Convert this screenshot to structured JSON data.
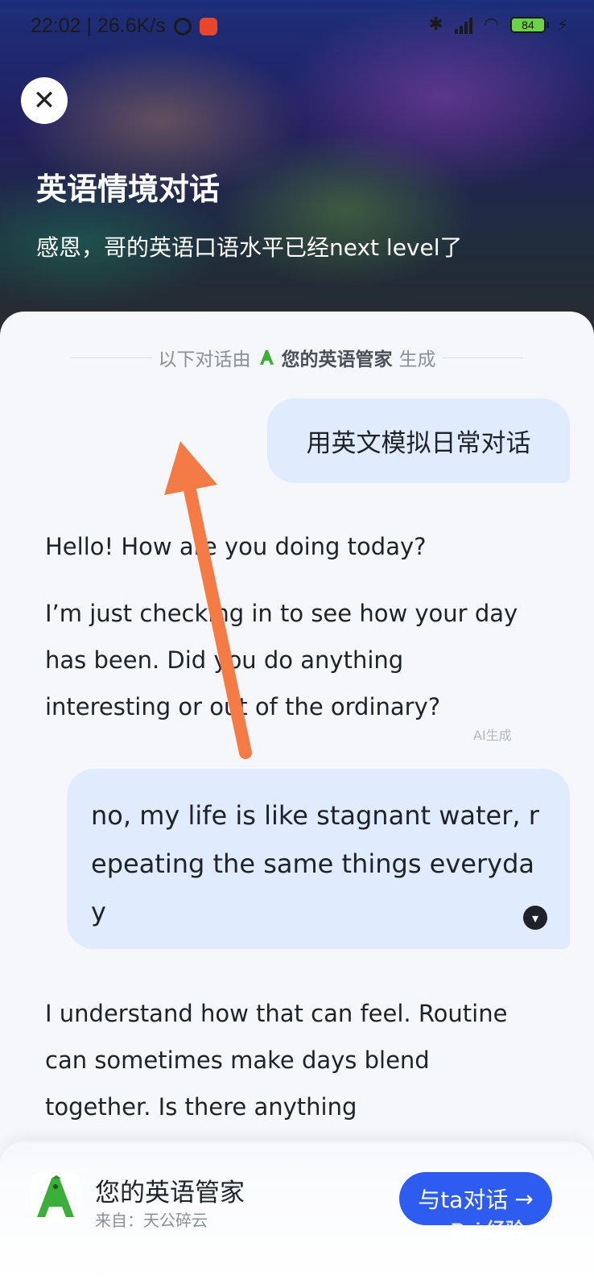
{
  "status": {
    "time_speed": "22:02 | 26.6K/s",
    "battery": "84"
  },
  "header": {
    "close_symbol": "✕",
    "title": "英语情境对话",
    "subtitle": "感恩，哥的英语口语水平已经next level了"
  },
  "source": {
    "prefix": "以下对话由",
    "agent": "您的英语管家",
    "suffix": "生成"
  },
  "messages": [
    {
      "role": "user",
      "text": "用英文模拟日常对话"
    },
    {
      "role": "ai",
      "paragraphs": [
        "Hello! How are you doing today?",
        "I’m just checking in to see how your day has been. Did you do anything interesting or out of the ordinary?"
      ],
      "tag": "AI生成"
    },
    {
      "role": "user",
      "text": "no, my life is like stagnant water, repeating the same things everyday"
    },
    {
      "role": "ai",
      "paragraphs": [
        "I understand how that can feel. Routine can sometimes make days blend together. Is there anything"
      ]
    }
  ],
  "footer": {
    "agent_name": "您的英语管家",
    "from": "来自：天公碎云",
    "chat_button": "与ta对话",
    "watermark": "Bai 经验"
  },
  "colors": {
    "accent": "#2e5cf0",
    "user_bubble": "#e0ecfd",
    "arrow": "#f47b45"
  }
}
